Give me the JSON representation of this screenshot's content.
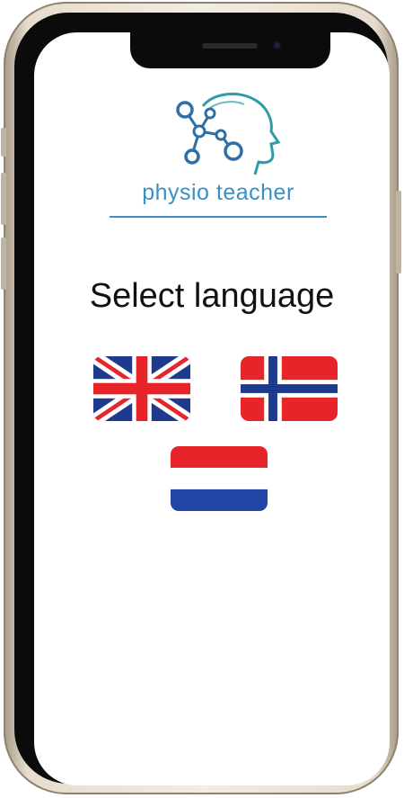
{
  "app": {
    "logo_text": "physio teacher",
    "title": "Select language"
  },
  "languages": [
    {
      "name": "English",
      "flag": "uk-flag-icon"
    },
    {
      "name": "Norwegian",
      "flag": "norway-flag-icon"
    },
    {
      "name": "Dutch",
      "flag": "netherlands-flag-icon"
    }
  ],
  "colors": {
    "brand": "#3c8fc1",
    "flag_red": "#e8242b",
    "flag_blue": "#1e3a8f",
    "netherlands_blue": "#2145a4"
  }
}
